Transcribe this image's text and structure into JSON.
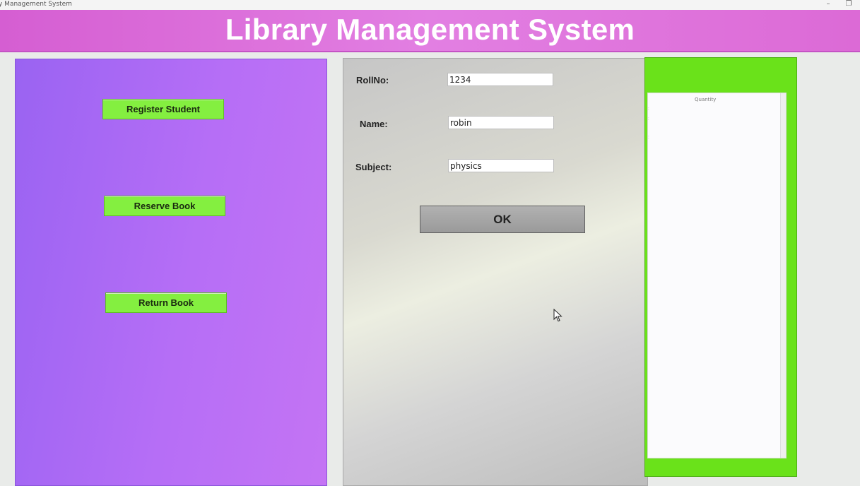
{
  "window": {
    "title": "y Management System",
    "minimize_glyph": "–",
    "restore_glyph": "❐"
  },
  "header": {
    "title": "Library Management System"
  },
  "sidebar": {
    "buttons": [
      {
        "label": "Register Student"
      },
      {
        "label": "Reserve Book"
      },
      {
        "label": "Return Book"
      }
    ]
  },
  "form": {
    "rollno_label": "RollNo:",
    "rollno_value": "1234",
    "name_label": "Name:",
    "name_value": "robin",
    "subject_label": "Subject:",
    "subject_value": "physics",
    "ok_label": "OK"
  },
  "table": {
    "column_header": "Quantity"
  },
  "colors": {
    "header_bg": "#dc6ad6",
    "sidebar_bg": "#b66ef6",
    "button_green": "#84ef40",
    "right_panel_green": "#6ae21a"
  }
}
